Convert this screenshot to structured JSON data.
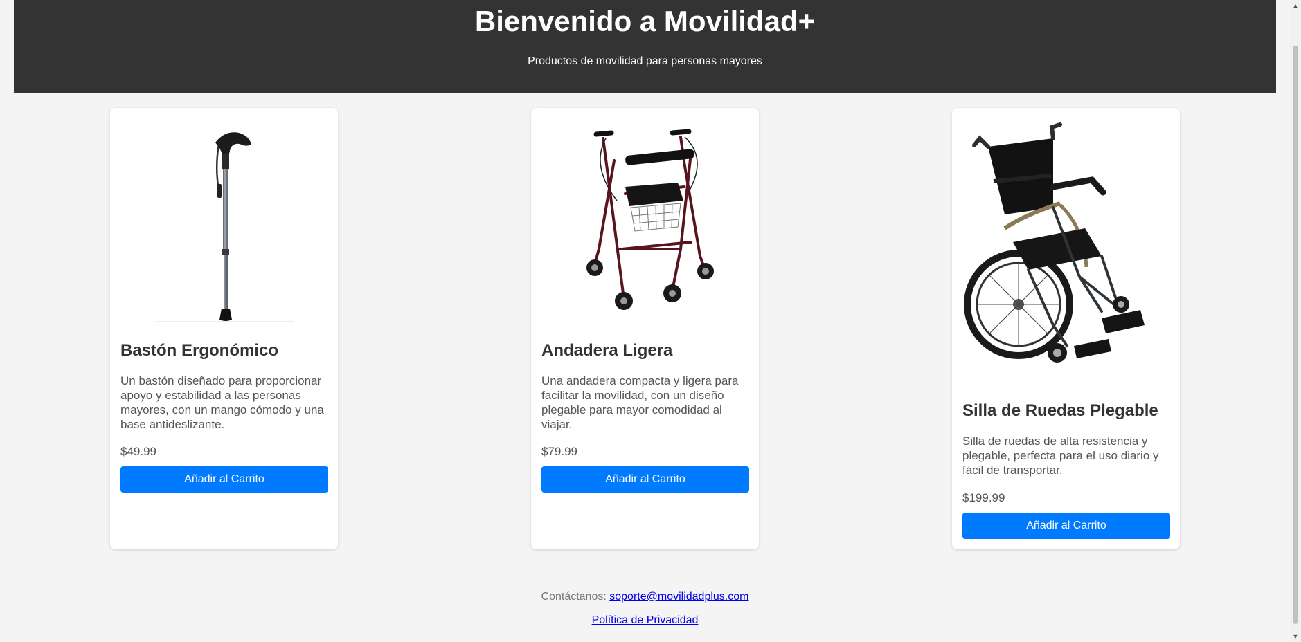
{
  "header": {
    "title": "Bienvenido a Movilidad+",
    "subtitle": "Productos de movilidad para personas mayores"
  },
  "products": [
    {
      "name": "Bastón Ergonómico",
      "description": "Un bastón diseñado para proporcionar apoyo y estabilidad a las personas mayores, con un mango cómodo y una base antideslizante.",
      "price": "$49.99",
      "button": "Añadir al Carrito",
      "image_icon": "cane-image"
    },
    {
      "name": "Andadera Ligera",
      "description": "Una andadera compacta y ligera para facilitar la movilidad, con un diseño plegable para mayor comodidad al viajar.",
      "price": "$79.99",
      "button": "Añadir al Carrito",
      "image_icon": "walker-image"
    },
    {
      "name": "Silla de Ruedas Plegable",
      "description": "Silla de ruedas de alta resistencia y plegable, perfecta para el uso diario y fácil de transportar.",
      "price": "$199.99",
      "button": "Añadir al Carrito",
      "image_icon": "wheelchair-image"
    }
  ],
  "footer": {
    "contact_label": "Contáctanos:",
    "contact_email": "soporte@movilidadplus.com",
    "privacy_link": "Política de Privacidad"
  },
  "colors": {
    "header_bg": "#333333",
    "button_bg": "#007bff",
    "page_bg": "#f4f4f4"
  }
}
